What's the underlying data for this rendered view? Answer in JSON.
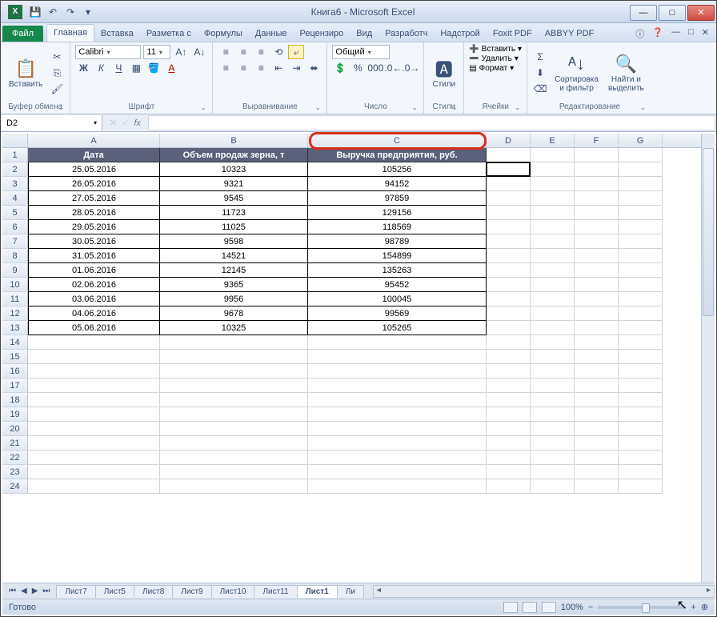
{
  "title": "Книга6 - Microsoft Excel",
  "qat": {
    "save": "💾",
    "undo": "↶",
    "redo": "↷"
  },
  "tabs": {
    "file": "Файл",
    "items": [
      "Главная",
      "Вставка",
      "Разметка с",
      "Формулы",
      "Данные",
      "Рецензиро",
      "Вид",
      "Разработч",
      "Надстрой",
      "Foxit PDF",
      "ABBYY PDF"
    ],
    "active": "Главная"
  },
  "ribbon": {
    "clipboard": {
      "label": "Буфер обмена",
      "paste": "Вставить"
    },
    "font": {
      "label": "Шрифт",
      "name": "Calibri",
      "size": "11"
    },
    "align": {
      "label": "Выравнивание"
    },
    "number": {
      "label": "Число",
      "format": "Общий"
    },
    "styles": {
      "label": "Стили",
      "btn": "Стили"
    },
    "cells": {
      "label": "Ячейки",
      "insert": "Вставить",
      "delete": "Удалить",
      "format": "Формат"
    },
    "editing": {
      "label": "Редактирование",
      "sort": "Сортировка\nи фильтр",
      "find": "Найти и\nвыделить"
    }
  },
  "formula": {
    "namebox": "D2",
    "fx": "fx",
    "value": ""
  },
  "columns": [
    "A",
    "B",
    "C",
    "D",
    "E",
    "F",
    "G"
  ],
  "headers": [
    "Дата",
    "Объем продаж зерна, т",
    "Выручка предприятия, руб."
  ],
  "rows": [
    {
      "n": "1"
    },
    {
      "n": "2",
      "d": "25.05.2016",
      "v": "10323",
      "r": "105256"
    },
    {
      "n": "3",
      "d": "26.05.2016",
      "v": "9321",
      "r": "94152"
    },
    {
      "n": "4",
      "d": "27.05.2016",
      "v": "9545",
      "r": "97859"
    },
    {
      "n": "5",
      "d": "28.05.2016",
      "v": "11723",
      "r": "129156"
    },
    {
      "n": "6",
      "d": "29.05.2016",
      "v": "11025",
      "r": "118569"
    },
    {
      "n": "7",
      "d": "30.05.2016",
      "v": "9598",
      "r": "98789"
    },
    {
      "n": "8",
      "d": "31.05.2016",
      "v": "14521",
      "r": "154899"
    },
    {
      "n": "9",
      "d": "01.06.2016",
      "v": "12145",
      "r": "135263"
    },
    {
      "n": "10",
      "d": "02.06.2016",
      "v": "9365",
      "r": "95452"
    },
    {
      "n": "11",
      "d": "03.06.2016",
      "v": "9956",
      "r": "100045"
    },
    {
      "n": "12",
      "d": "04.06.2016",
      "v": "9678",
      "r": "99569"
    },
    {
      "n": "13",
      "d": "05.06.2016",
      "v": "10325",
      "r": "105265"
    },
    {
      "n": "14"
    },
    {
      "n": "15"
    },
    {
      "n": "16"
    },
    {
      "n": "17"
    },
    {
      "n": "18"
    },
    {
      "n": "19"
    },
    {
      "n": "20"
    },
    {
      "n": "21"
    },
    {
      "n": "22"
    },
    {
      "n": "23"
    },
    {
      "n": "24"
    }
  ],
  "sheets": {
    "items": [
      "Лист7",
      "Лист5",
      "Лист8",
      "Лист9",
      "Лист10",
      "Лист11",
      "Лист1",
      "Ли"
    ],
    "active": "Лист1"
  },
  "status": {
    "ready": "Готово",
    "zoom": "100%",
    "minus": "−",
    "plus": "+",
    "expand": "⊕"
  }
}
